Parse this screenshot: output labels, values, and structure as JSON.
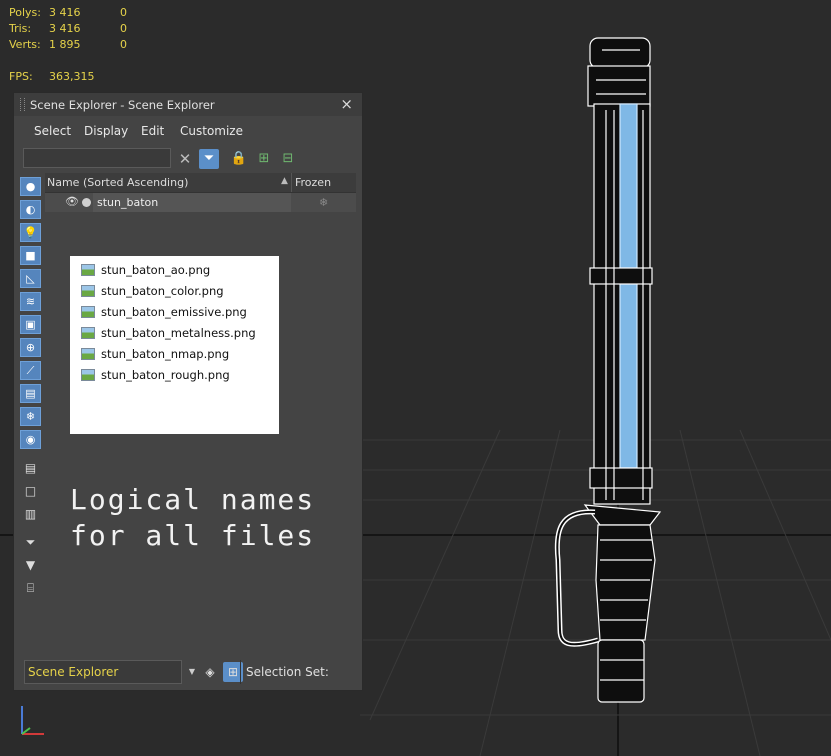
{
  "stats": {
    "polys_label": "Polys:",
    "polys_total": "3 416",
    "polys_sel": "0",
    "tris_label": "Tris:",
    "tris_total": "3 416",
    "tris_sel": "0",
    "verts_label": "Verts:",
    "verts_total": "1 895",
    "verts_sel": "0",
    "fps_label": "FPS:",
    "fps_value": "363,315"
  },
  "explorer": {
    "title": "Scene Explorer - Scene Explorer",
    "close": "×",
    "menu": [
      "Select",
      "Display",
      "Edit",
      "Customize"
    ],
    "search": {
      "value": "",
      "placeholder": ""
    },
    "columns": {
      "name": "Name (Sorted Ascending)",
      "sort_indicator": "▲",
      "frozen": "Frozen"
    },
    "rows": [
      {
        "name": "stun_baton"
      }
    ],
    "bottom": {
      "scene_explorer": "Scene Explorer",
      "selection_set": "Selection Set:"
    }
  },
  "files": [
    "stun_baton_ao.png",
    "stun_baton_color.png",
    "stun_baton_emissive.png",
    "stun_baton_metalness.png",
    "stun_baton_nmap.png",
    "stun_baton_rough.png"
  ],
  "caption": {
    "line1": "Logical names",
    "line2": "for all files"
  },
  "colors": {
    "stat_text": "#e6d34a",
    "accent": "#5585bd",
    "emissive": "#7fb8e6"
  },
  "icons": {
    "sidebar": [
      "geometry-icon",
      "shape-icon",
      "light-icon",
      "camera-icon",
      "helper-icon",
      "spacewarp-icon",
      "group-icon",
      "xref-icon",
      "bone-icon",
      "container-icon",
      "frozen-icon",
      "hidden-icon",
      "display-all-icon",
      "display-none-icon",
      "invert-icon",
      "filter-icon",
      "funnel-icon",
      "layer-icon"
    ]
  }
}
